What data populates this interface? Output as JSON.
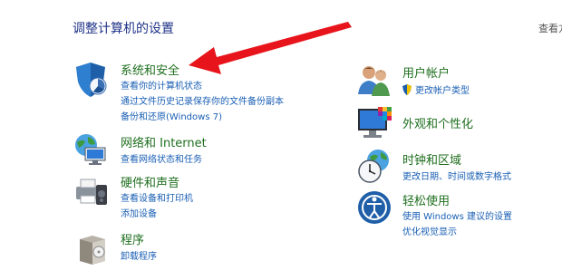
{
  "header": {
    "title": "调整计算机的设置",
    "view_by": "查看方"
  },
  "categories": {
    "system_security": {
      "title": "系统和安全",
      "icon": "shield-icon",
      "links": [
        "查看你的计算机状态",
        "通过文件历史记录保存你的文件备份副本",
        "备份和还原(Windows 7)"
      ]
    },
    "network": {
      "title": "网络和 Internet",
      "icon": "globe-network-icon",
      "links": [
        "查看网络状态和任务"
      ]
    },
    "hardware": {
      "title": "硬件和声音",
      "icon": "printer-speaker-icon",
      "links": [
        "查看设备和打印机",
        "添加设备"
      ]
    },
    "programs": {
      "title": "程序",
      "icon": "programs-box-icon",
      "links": [
        "卸载程序"
      ]
    },
    "user_accounts": {
      "title": "用户帐户",
      "icon": "users-icon",
      "links": [
        "更改帐户类型"
      ]
    },
    "appearance": {
      "title": "外观和个性化",
      "icon": "monitor-palette-icon",
      "links": []
    },
    "clock": {
      "title": "时钟和区域",
      "icon": "clock-globe-icon",
      "links": [
        "更改日期、时间或数字格式"
      ]
    },
    "ease": {
      "title": "轻松使用",
      "icon": "ease-of-access-icon",
      "links": [
        "使用 Windows 建议的设置",
        "优化视觉显示"
      ]
    }
  },
  "annotation": {
    "arrow_color": "#e8141c"
  }
}
